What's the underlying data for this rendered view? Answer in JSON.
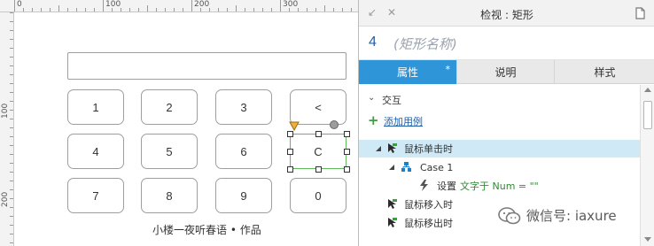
{
  "ruler": {
    "top_labels": [
      "0",
      "100",
      "200",
      "300"
    ],
    "left_labels": [
      "100",
      "200"
    ]
  },
  "canvas": {
    "keys": [
      {
        "label": "1"
      },
      {
        "label": "2"
      },
      {
        "label": "3"
      },
      {
        "label": "<"
      },
      {
        "label": "4"
      },
      {
        "label": "5"
      },
      {
        "label": "6"
      },
      {
        "label": "C"
      },
      {
        "label": "7"
      },
      {
        "label": "8"
      },
      {
        "label": "9"
      },
      {
        "label": "0"
      }
    ],
    "caption": "小楼一夜听春语 • 作品"
  },
  "inspector": {
    "title": "检视 : 矩形",
    "shape_number": "4",
    "shape_name_placeholder": "(矩形名称)",
    "tabs": [
      {
        "label": "属性",
        "modified": "*"
      },
      {
        "label": "说明"
      },
      {
        "label": "样式"
      }
    ],
    "interaction_header": "交互",
    "add_case": "添加用例",
    "events": {
      "onclick": "鼠标单击时",
      "case1": "Case 1",
      "action_label": "设置",
      "action_detail": "文字于 Num = \"\"",
      "mouse_enter": "鼠标移入时",
      "mouse_leave": "鼠标移出时"
    }
  },
  "watermark": "微信号: iaxure",
  "colors": {
    "accent": "#2f95d9",
    "selection_green": "#5fb85a",
    "highlight_row": "#cfe9f6",
    "action_green": "#2d8c30"
  }
}
